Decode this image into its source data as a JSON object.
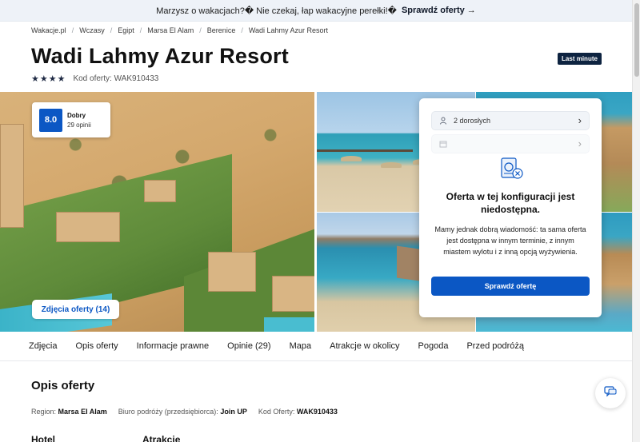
{
  "promo": {
    "text": "Marzysz o wakacjach?� Nie czekaj, łap wakacyjne perełki!�",
    "link": "Sprawdź oferty",
    "arrow": "→"
  },
  "breadcrumb": [
    "Wakacje.pl",
    "Wczasy",
    "Egipt",
    "Marsa El Alam",
    "Berenice",
    "Wadi Lahmy Azur Resort"
  ],
  "breadcrumb_separator": "/",
  "hotel": {
    "title": "Wadi Lahmy Azur Resort",
    "badge": "Last minute",
    "stars": "★★★★",
    "offer_code": "Kod oferty: WAK910433"
  },
  "rating": {
    "score": "8.0",
    "label": "Dobry",
    "count": "29 opinii"
  },
  "gallery": {
    "photos_button": "Zdjęcia oferty (14)"
  },
  "booking": {
    "travelers": "2 dorosłych",
    "date": "",
    "unavailable_title": "Oferta w tej konfiguracji jest niedostępna.",
    "unavailable_desc": "Mamy jednak dobrą wiadomość: ta sama oferta jest dostępna w innym terminie, z innym miastem wylotu i z inną opcją wyżywienia.",
    "button": "Sprawdź ofertę",
    "icons": [
      "person-icon",
      "calendar-icon",
      "chevron-right-icon",
      "offer-unavailable-icon"
    ]
  },
  "tabs": [
    "Zdjęcia",
    "Opis oferty",
    "Informacje prawne",
    "Opinie (29)",
    "Mapa",
    "Atrakcje w okolicy",
    "Pogoda",
    "Przed podróżą"
  ],
  "description": {
    "title": "Opis oferty",
    "region_label": "Region:",
    "region_value": "Marsa El Alam",
    "agency_label": "Biuro podróży (przedsiębiorca):",
    "agency_value": "Join UP",
    "code_label": "Kod Oferty:",
    "code_value": "WAK910433",
    "col_hotel": "Hotel",
    "col_attractions": "Atrakcje"
  },
  "colors": {
    "primary": "#0b57c4",
    "badge": "#0d2340",
    "promo_bg": "#eef2f8"
  }
}
